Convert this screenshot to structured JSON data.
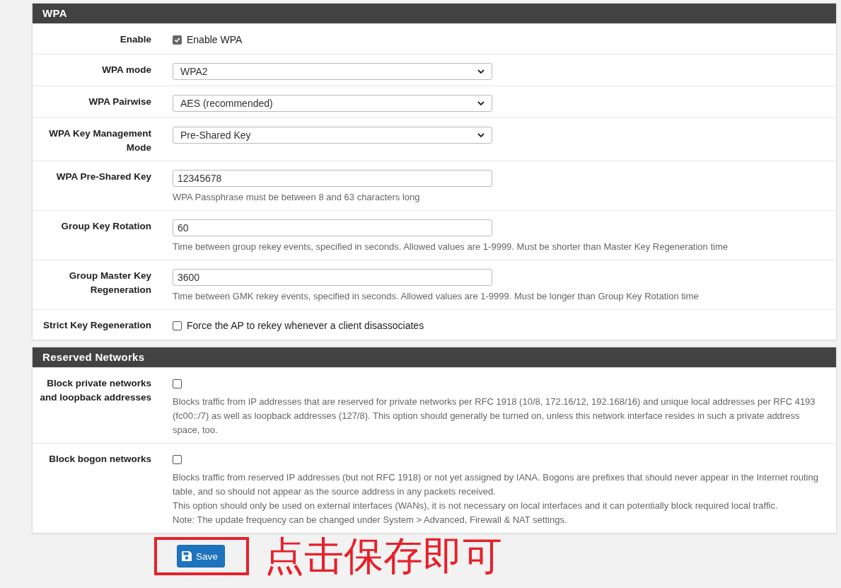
{
  "sections": [
    {
      "title": "WPA",
      "rows": [
        {
          "label": "Enable",
          "kind": "checkbox",
          "checked": true,
          "text": "Enable WPA"
        },
        {
          "label": "WPA mode",
          "kind": "select",
          "value": "WPA2"
        },
        {
          "label": "WPA Pairwise",
          "kind": "select",
          "value": "AES (recommended)"
        },
        {
          "label": "WPA Key Management Mode",
          "kind": "select",
          "value": "Pre-Shared Key"
        },
        {
          "label": "WPA Pre-Shared Key",
          "kind": "input",
          "value": "12345678",
          "help": "WPA Passphrase must be between 8 and 63 characters long"
        },
        {
          "label": "Group Key Rotation",
          "kind": "input",
          "value": "60",
          "help": "Time between group rekey events, specified in seconds. Allowed values are 1-9999. Must be shorter than Master Key Regeneration time"
        },
        {
          "label": "Group Master Key Regeneration",
          "kind": "input",
          "value": "3600",
          "help": "Time between GMK rekey events, specified in seconds. Allowed values are 1-9999. Must be longer than Group Key Rotation time"
        },
        {
          "label": "Strict Key Regeneration",
          "kind": "checkbox",
          "checked": false,
          "text": "Force the AP to rekey whenever a client disassociates"
        }
      ]
    },
    {
      "title": "Reserved Networks",
      "rows": [
        {
          "label": "Block private networks and loopback addresses",
          "kind": "checkbox",
          "checked": false,
          "help": "Blocks traffic from IP addresses that are reserved for private networks per RFC 1918 (10/8, 172.16/12, 192.168/16) and unique local addresses per RFC 4193 (fc00::/7) as well as loopback addresses (127/8). This option should generally be turned on, unless this network interface resides in such a private address space, too."
        },
        {
          "label": "Block bogon networks",
          "kind": "checkbox",
          "checked": false,
          "help": "Blocks traffic from reserved IP addresses (but not RFC 1918) or not yet assigned by IANA. Bogons are prefixes that should never appear in the Internet routing table, and so should not appear as the source address in any packets received.\nThis option should only be used on external interfaces (WANs), it is not necessary on local interfaces and it can potentially block required local traffic.\nNote: The update frequency can be changed under System > Advanced, Firewall & NAT settings."
        }
      ]
    }
  ],
  "save_button": {
    "label": "Save"
  },
  "annotation": "点击保存即可"
}
